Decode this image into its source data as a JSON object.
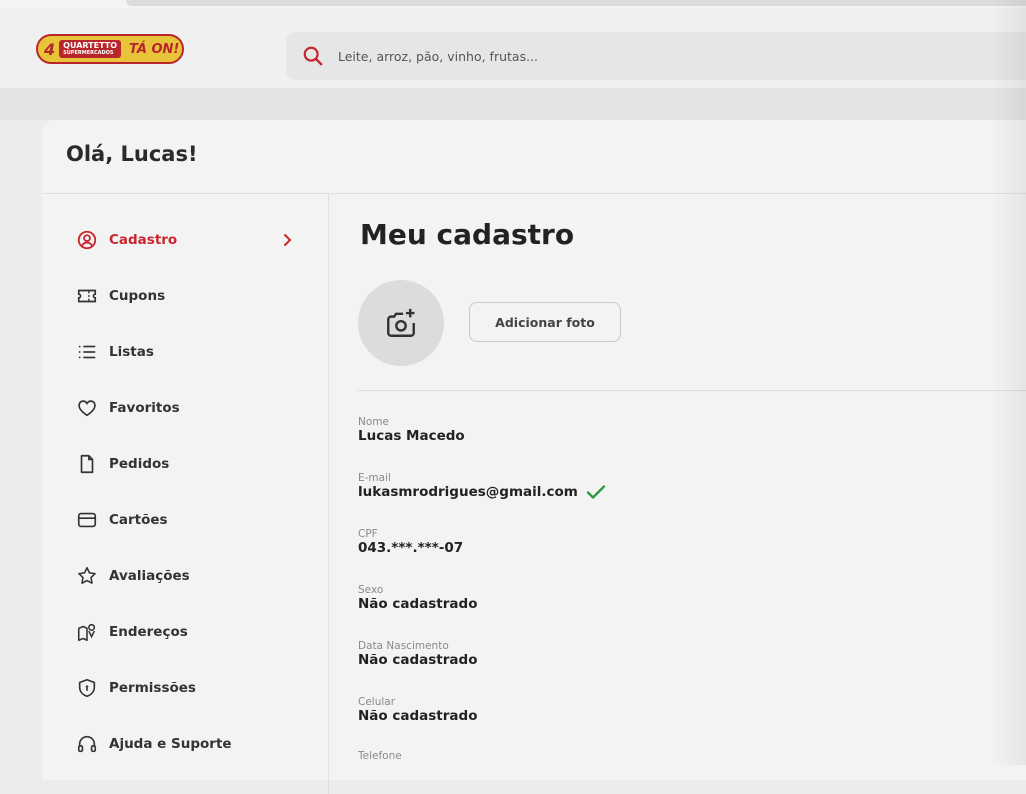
{
  "header": {
    "logo": {
      "number": "4",
      "brand_top": "QUARTETTO",
      "brand_bottom": "SUPERMERCADOS",
      "slogan": "TÁ ON!"
    },
    "search": {
      "placeholder": "Leite, arroz, pão, vinho, frutas..."
    }
  },
  "greeting": "Olá, Lucas!",
  "sidebar": {
    "items": [
      {
        "label": "Cadastro",
        "icon": "user-circle-icon",
        "active": true
      },
      {
        "label": "Cupons",
        "icon": "ticket-icon"
      },
      {
        "label": "Listas",
        "icon": "list-icon"
      },
      {
        "label": "Favoritos",
        "icon": "heart-icon"
      },
      {
        "label": "Pedidos",
        "icon": "document-icon"
      },
      {
        "label": "Cartões",
        "icon": "credit-card-icon"
      },
      {
        "label": "Avaliações",
        "icon": "star-icon"
      },
      {
        "label": "Endereços",
        "icon": "map-pin-icon"
      },
      {
        "label": "Permissões",
        "icon": "shield-icon"
      },
      {
        "label": "Ajuda e Suporte",
        "icon": "headset-icon"
      }
    ]
  },
  "profile": {
    "title": "Meu cadastro",
    "add_photo_label": "Adicionar foto",
    "fields": [
      {
        "label": "Nome",
        "value": "Lucas Macedo"
      },
      {
        "label": "E-mail",
        "value": "lukasmrodrigues@gmail.com",
        "verified": true
      },
      {
        "label": "CPF",
        "value": "043.***.***-07"
      },
      {
        "label": "Sexo",
        "value": "Não cadastrado"
      },
      {
        "label": "Data Nascimento",
        "value": "Não cadastrado"
      },
      {
        "label": "Celular",
        "value": "Não cadastrado"
      },
      {
        "label": "Telefone",
        "value": ""
      }
    ]
  },
  "colors": {
    "accent": "#c8262f",
    "verified": "#2e9a3e",
    "logo_yellow": "#e8c43a"
  }
}
